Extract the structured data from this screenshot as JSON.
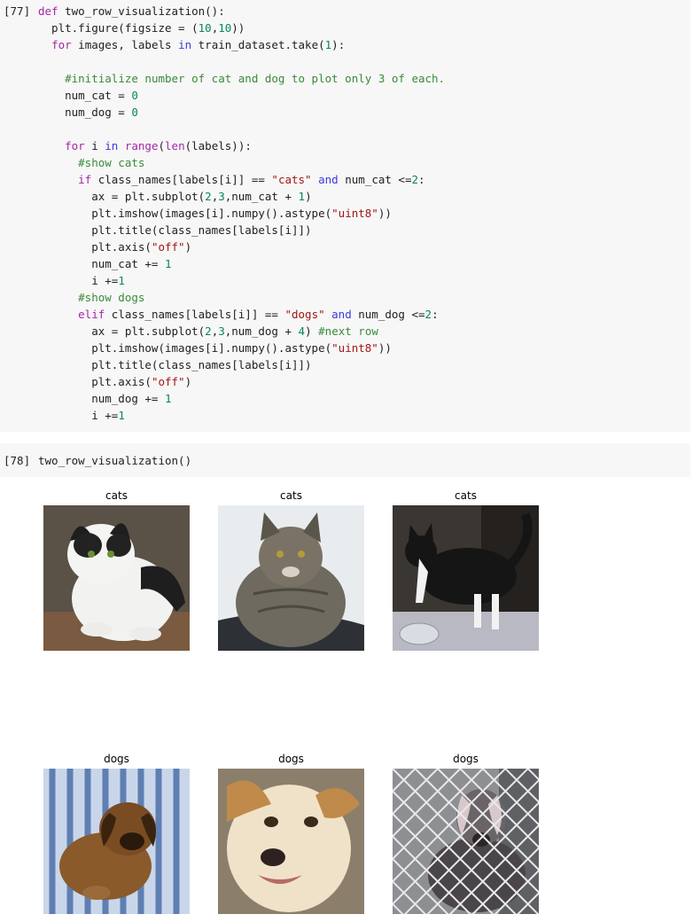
{
  "cell1": {
    "exec_count": "[77]",
    "lines": [
      "def two_row_visualization():",
      "  plt.figure(figsize = (10,10))",
      "  for images, labels in train_dataset.take(1):",
      "",
      "    #initialize number of cat and dog to plot only 3 of each.",
      "    num_cat = 0",
      "    num_dog = 0",
      "",
      "    for i in range(len(labels)):",
      "      #show cats",
      "      if class_names[labels[i]] == \"cats\" and num_cat <=2:",
      "        ax = plt.subplot(2,3,num_cat + 1)",
      "        plt.imshow(images[i].numpy().astype(\"uint8\"))",
      "        plt.title(class_names[labels[i]])",
      "        plt.axis(\"off\")",
      "        num_cat += 1",
      "        i +=1",
      "      #show dogs",
      "      elif class_names[labels[i]] == \"dogs\" and num_dog <=2:",
      "        ax = plt.subplot(2,3,num_dog + 4) #next row",
      "        plt.imshow(images[i].numpy().astype(\"uint8\"))",
      "        plt.title(class_names[labels[i]])",
      "        plt.axis(\"off\")",
      "        num_dog += 1",
      "        i +=1"
    ]
  },
  "cell2": {
    "exec_count": "[78]",
    "code": "two_row_visualization()"
  },
  "figure": {
    "titles": [
      "cats",
      "cats",
      "cats",
      "dogs",
      "dogs",
      "dogs"
    ]
  }
}
